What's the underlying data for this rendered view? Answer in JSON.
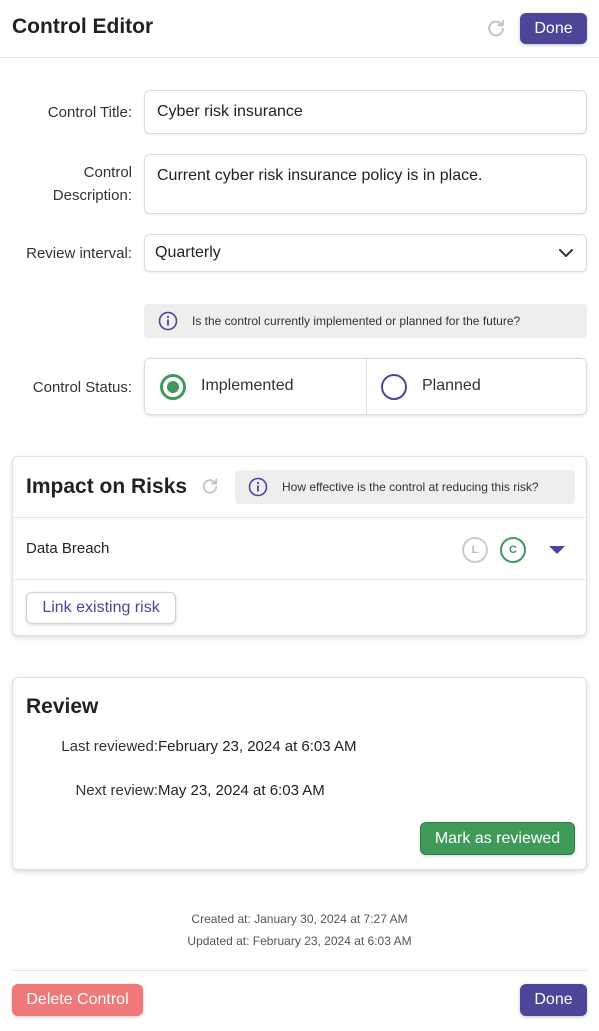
{
  "header": {
    "title": "Control Editor",
    "done_label": "Done"
  },
  "form": {
    "title_label": "Control Title:",
    "title_value": "Cyber risk insurance",
    "description_label_line1": "Control",
    "description_label_line2": "Description:",
    "description_value": "Current cyber risk insurance policy is in place.",
    "interval_label": "Review interval:",
    "interval_value": "Quarterly",
    "status_info": "Is the control currently implemented or planned for the future?",
    "status_label": "Control Status:",
    "status_options": [
      {
        "label": "Implemented",
        "selected": true
      },
      {
        "label": "Planned",
        "selected": false
      }
    ]
  },
  "impact": {
    "title": "Impact on Risks",
    "info": "How effective is the control at reducing this risk?",
    "risks": [
      {
        "name": "Data Breach",
        "badge_l": "L",
        "badge_c": "C"
      }
    ],
    "link_button": "Link existing risk"
  },
  "review": {
    "title": "Review",
    "last_label": "Last reviewed:",
    "last_value": "February 23, 2024 at 6:03 AM",
    "next_label": "Next review:",
    "next_value": "May 23, 2024 at 6:03 AM",
    "mark_button": "Mark as reviewed"
  },
  "meta": {
    "created": "Created at: January 30, 2024 at 7:27 AM",
    "updated": "Updated at: February 23, 2024 at 6:03 AM"
  },
  "footer": {
    "delete_label": "Delete Control",
    "done_label": "Done"
  },
  "colors": {
    "primary": "#4c4699",
    "success": "#3f9a5a",
    "danger": "#f07878",
    "muted": "#bbbbbb"
  }
}
